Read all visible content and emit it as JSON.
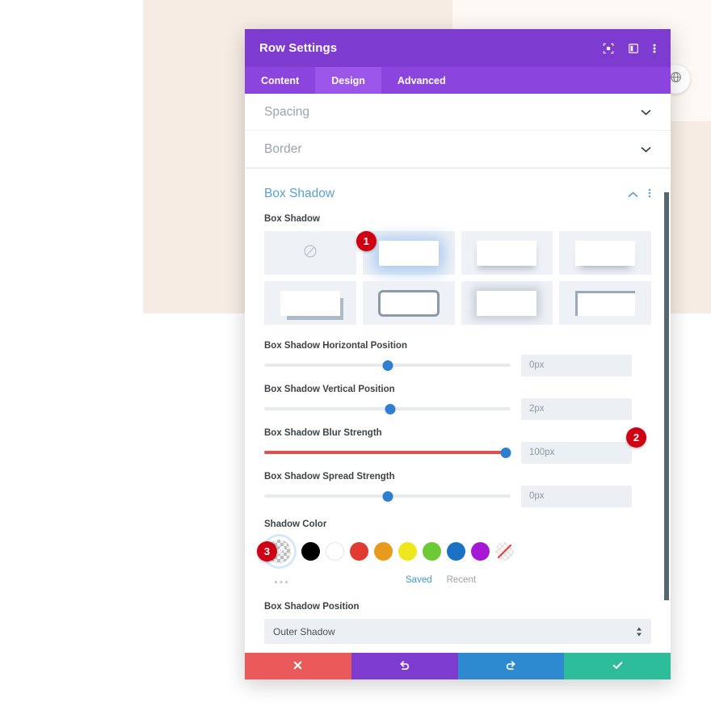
{
  "window": {
    "title": "Row Settings",
    "header_icons": [
      {
        "name": "fullscreen-icon",
        "glyph": "⬚"
      },
      {
        "name": "layout-columns-icon",
        "glyph": "▣"
      },
      {
        "name": "more-vertical-icon",
        "glyph": "⋮"
      }
    ],
    "tabs": [
      {
        "label": "Content",
        "active": false
      },
      {
        "label": "Design",
        "active": true
      },
      {
        "label": "Advanced",
        "active": false
      }
    ]
  },
  "floating": {
    "icon": "globe-icon",
    "glyph": "◍"
  },
  "sections": {
    "collapsed": [
      {
        "label": "Spacing",
        "icon": "chevron-down-icon"
      },
      {
        "label": "Border",
        "icon": "chevron-down-icon"
      }
    ],
    "open": {
      "label": "Box Shadow",
      "collapse_icon": "chevron-up-icon",
      "more_icon": "more-vertical-icon"
    }
  },
  "box_shadow": {
    "preset_label": "Box Shadow",
    "presets": [
      {
        "name": "preset-none",
        "style": "p-none",
        "selected": false,
        "badge": null
      },
      {
        "name": "preset-glow",
        "style": "p1",
        "selected": true,
        "badge": "1"
      },
      {
        "name": "preset-drop-soft",
        "style": "p2",
        "selected": false,
        "badge": null
      },
      {
        "name": "preset-drop-wide",
        "style": "p3",
        "selected": false,
        "badge": null
      },
      {
        "name": "preset-offset-solid",
        "style": "p4",
        "selected": false,
        "badge": null
      },
      {
        "name": "preset-outline",
        "style": "p5",
        "selected": false,
        "badge": null
      },
      {
        "name": "preset-blur-all",
        "style": "p6",
        "selected": false,
        "badge": null
      },
      {
        "name": "preset-inset",
        "style": "p7",
        "selected": false,
        "badge": null
      }
    ],
    "sliders": [
      {
        "name": "horizontal-position",
        "label": "Box Shadow Horizontal Position",
        "value": "0px",
        "knob_percent": 50,
        "fill_percent": 0
      },
      {
        "name": "vertical-position",
        "label": "Box Shadow Vertical Position",
        "value": "2px",
        "knob_percent": 51,
        "fill_percent": 0
      },
      {
        "name": "blur-strength",
        "label": "Box Shadow Blur Strength",
        "value": "100px",
        "knob_percent": 98,
        "fill_percent": 98,
        "badge": "2"
      },
      {
        "name": "spread-strength",
        "label": "Box Shadow Spread Strength",
        "value": "0px",
        "knob_percent": 50,
        "fill_percent": 0
      }
    ],
    "shadow_color": {
      "label": "Shadow Color",
      "picker": {
        "name": "color-picker-eyedropper",
        "badge": "3",
        "glyph": "✐"
      },
      "swatches": [
        {
          "name": "swatch-black",
          "color": "#000000"
        },
        {
          "name": "swatch-white",
          "color": "#ffffff"
        },
        {
          "name": "swatch-red",
          "color": "#e03a32"
        },
        {
          "name": "swatch-orange",
          "color": "#e89a1c"
        },
        {
          "name": "swatch-yellow",
          "color": "#eee71c"
        },
        {
          "name": "swatch-green",
          "color": "#6dca35"
        },
        {
          "name": "swatch-blue",
          "color": "#1a72c4"
        },
        {
          "name": "swatch-purple",
          "color": "#a718d6"
        },
        {
          "name": "swatch-transparent",
          "color": "transparent"
        }
      ],
      "more_icon": "more-horizontal-icon",
      "saved_label": "Saved",
      "recent_label": "Recent"
    },
    "position": {
      "label": "Box Shadow Position",
      "value": "Outer Shadow"
    }
  },
  "footer": {
    "buttons": [
      {
        "name": "cancel-button",
        "glyph": "✖",
        "class": "fb-cancel"
      },
      {
        "name": "undo-button",
        "glyph": "↺",
        "class": "fb-undo"
      },
      {
        "name": "redo-button",
        "glyph": "↻",
        "class": "fb-redo"
      },
      {
        "name": "save-button",
        "glyph": "✔",
        "class": "fb-save"
      }
    ]
  },
  "colors": {
    "header_purple": "#7e3bd0",
    "tabs_purple": "#8c44de",
    "accent_blue": "#2e7fd0",
    "badge_red": "#d00014"
  }
}
